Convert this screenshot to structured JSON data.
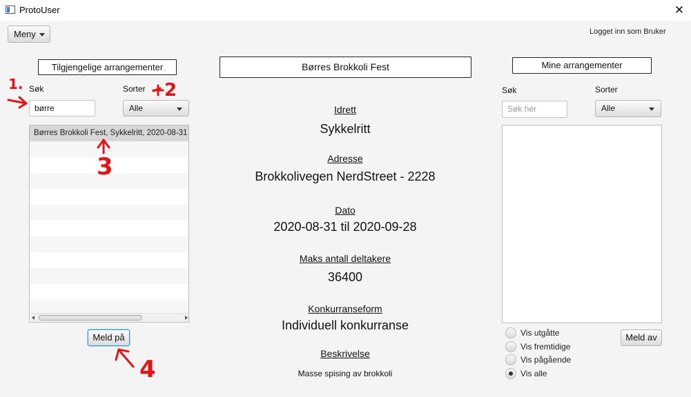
{
  "window": {
    "title": "ProtoUser",
    "close_glyph": "✕",
    "icon": "app-icon"
  },
  "header": {
    "menu_label": "Meny",
    "login_info": "Logget inn som Bruker"
  },
  "left_panel": {
    "heading": "Tilgjengelige arrangementer",
    "search_label": "Søk",
    "search_value": "børre",
    "sort_label": "Sorter",
    "sort_value": "Alle",
    "items": [
      "Børres Brokkoli Fest, Sykkelritt, 2020-08-31"
    ],
    "selected_index": 0,
    "join_button": "Meld på"
  },
  "details": {
    "event_name": "Børres Brokkoli Fest",
    "sport_label": "Idrett",
    "sport_value": "Sykkelritt",
    "address_label": "Adresse",
    "address_value": "Brokkolivegen NerdStreet - 2228",
    "date_label": "Dato",
    "date_value": "2020-08-31 til 2020-09-28",
    "max_label": "Maks antall deltakere",
    "max_value": "36400",
    "form_label": "Konkurranseform",
    "form_value": "Individuell konkurranse",
    "desc_label": "Beskrivelse",
    "desc_value": "Masse spising av brokkoli"
  },
  "right_panel": {
    "heading": "Mine arrangementer",
    "search_label": "Søk",
    "search_placeholder": "Søk her",
    "sort_label": "Sorter",
    "sort_value": "Alle",
    "filters": [
      {
        "label": "Vis utgåtte",
        "checked": false
      },
      {
        "label": "Vis fremtidige",
        "checked": false
      },
      {
        "label": "Vis pågående",
        "checked": false
      },
      {
        "label": "Vis alle",
        "checked": true
      }
    ],
    "leave_button": "Meld av"
  },
  "annotations": {
    "step1": "1.",
    "step2": "2",
    "step3": "3",
    "step4": "4",
    "color": "#e01515"
  }
}
